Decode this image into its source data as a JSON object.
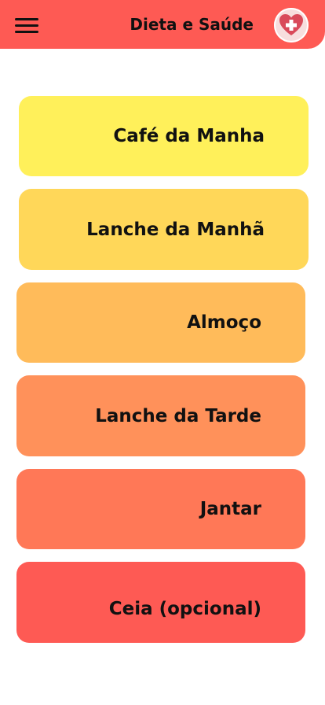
{
  "header": {
    "title": "Dieta e Saúde",
    "background": "#fe5a54",
    "menu_icon": "hamburger-menu-icon",
    "logo_icon": "heart-plus-icon"
  },
  "meals": [
    {
      "label": "Café da Manha",
      "color": "#fff05a"
    },
    {
      "label": "Lanche da Manhã",
      "color": "#ffd759"
    },
    {
      "label": "Almoço",
      "color": "#ffbb5a"
    },
    {
      "label": "Lanche da Tarde",
      "color": "#ff915a"
    },
    {
      "label": "Jantar",
      "color": "#ff7857"
    },
    {
      "label": "Ceia (opcional)",
      "color": "#fe5a54"
    }
  ]
}
